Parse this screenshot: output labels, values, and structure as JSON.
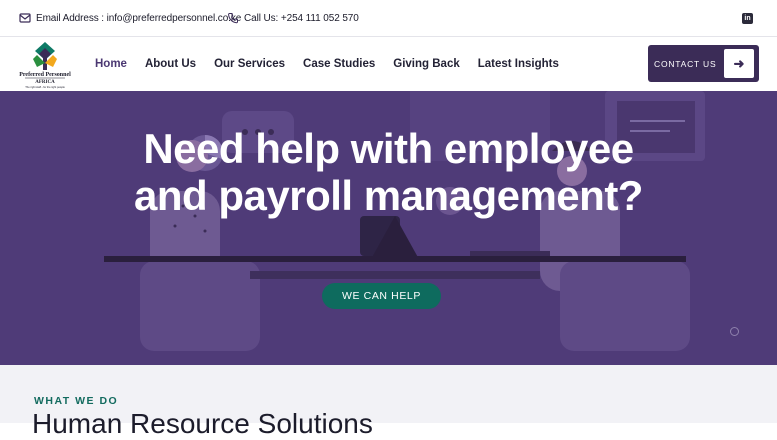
{
  "topbar": {
    "email_label": "Email Address : info@preferredpersonnel.co.ke",
    "phone_label": "Call Us: +254 111 052 570",
    "social_icon": "linkedin-icon",
    "social_text": "in"
  },
  "logo": {
    "name_line1": "Preferred Personnel",
    "name_line2": "AFRICA",
    "tagline": "The right staff...for the right people"
  },
  "nav": {
    "items": [
      {
        "label": "Home",
        "active": true
      },
      {
        "label": "About Us"
      },
      {
        "label": "Our Services"
      },
      {
        "label": "Case Studies"
      },
      {
        "label": "Giving Back"
      },
      {
        "label": "Latest Insights"
      }
    ],
    "contact_label": "CONTACT US",
    "contact_icon": "arrow-right-icon"
  },
  "hero": {
    "title": "Need help with employee and payroll management?",
    "button_label": "WE CAN HELP",
    "colors": {
      "background": "#4f3b78",
      "button": "#0e6b5e"
    }
  },
  "section": {
    "eyebrow": "WHAT WE DO",
    "title": "Human Resource Solutions"
  }
}
